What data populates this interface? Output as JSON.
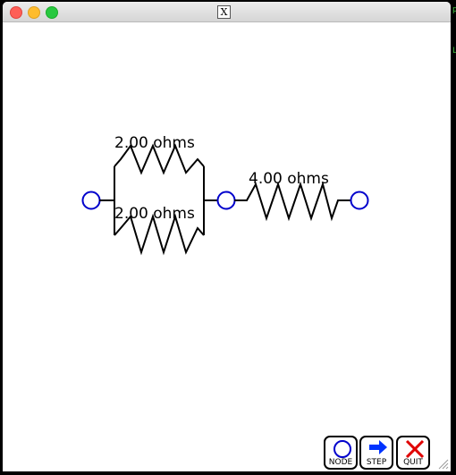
{
  "window": {
    "title_icon": "X"
  },
  "circuit": {
    "resistors": [
      {
        "label": "2.00 ohms"
      },
      {
        "label": "2.00 ohms"
      },
      {
        "label": "4.00 ohms"
      }
    ],
    "node_color": "#0000cc"
  },
  "toolbar": {
    "node_label": "NODE",
    "step_label": "STEP",
    "quit_label": "QUIT"
  },
  "colors": {
    "node_blue": "#0000cc",
    "step_arrow": "#0033ff",
    "quit_red": "#e00000"
  }
}
